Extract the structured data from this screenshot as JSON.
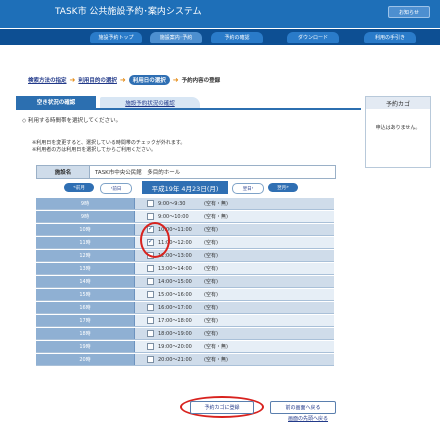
{
  "app": {
    "title": "TASK市 公共施設予約･案内システム",
    "top_button_label": "お知らせ"
  },
  "nav": {
    "tabs": [
      "施設予約トップ",
      "施設案内･予約",
      "予約の確認",
      "ダウンロード",
      "利用の手引き"
    ]
  },
  "breadcrumb": {
    "step1": "検索方法の指定",
    "step2": "利用目的の選択",
    "step3_current": "利用日の選択",
    "step4": "予約内容の登録"
  },
  "tabs": {
    "active": "空き状況の確認",
    "inactive": "施設予約状況の確認"
  },
  "sidebar": {
    "title": "予約カゴ",
    "empty_text": "申込はありません。"
  },
  "section": {
    "heading": "利用する時間帯を選択してください。"
  },
  "instructions": {
    "line1": "※利用日を変更すると、選択している時間帯のチェックが外れます。",
    "line2": "※利用者の方は利用日を選択してからご利用ください。"
  },
  "facility": {
    "label": "施設名",
    "value": "TASK市中央公民館　多目的ホール"
  },
  "date_nav": {
    "prev_month": "前月",
    "prev_day": "前日",
    "date": "平成19年 4月23日(月)",
    "next_day": "翌日",
    "next_month": "翌月"
  },
  "slots": [
    {
      "room": "9時",
      "time": "9:00〜9:30",
      "status": "(空有・無)",
      "checked": false
    },
    {
      "room": "9時",
      "time": "9:00〜10:00",
      "status": "(空有・無)",
      "checked": false
    },
    {
      "room": "10時",
      "time": "10:00〜11:00",
      "status": "(空有)",
      "checked": true
    },
    {
      "room": "11時",
      "time": "11:00〜12:00",
      "status": "(空有)",
      "checked": true
    },
    {
      "room": "12時",
      "time": "12:00〜13:00",
      "status": "(空有)",
      "checked": false
    },
    {
      "room": "13時",
      "time": "13:00〜14:00",
      "status": "(空有)",
      "checked": false
    },
    {
      "room": "14時",
      "time": "14:00〜15:00",
      "status": "(空有)",
      "checked": false
    },
    {
      "room": "15時",
      "time": "15:00〜16:00",
      "status": "(空有)",
      "checked": false
    },
    {
      "room": "16時",
      "time": "16:00〜17:00",
      "status": "(空有)",
      "checked": false
    },
    {
      "room": "17時",
      "time": "17:00〜18:00",
      "status": "(空有)",
      "checked": false
    },
    {
      "room": "18時",
      "time": "18:00〜19:00",
      "status": "(空有)",
      "checked": false
    },
    {
      "room": "19時",
      "time": "19:00〜20:00",
      "status": "(空有・無)",
      "checked": false
    },
    {
      "room": "20時",
      "time": "20:00〜21:00",
      "status": "(空有・無)",
      "checked": false
    }
  ],
  "actions": {
    "next_label": "予約カゴに登録",
    "back_label": "前の画面へ戻る",
    "top_link": "画面の先頭へ戻る"
  },
  "colors": {
    "header": "#1e6fb8",
    "navbar": "#0d4f93",
    "accent": "#2f6fb3",
    "highlight_oval": "#d8221e"
  }
}
